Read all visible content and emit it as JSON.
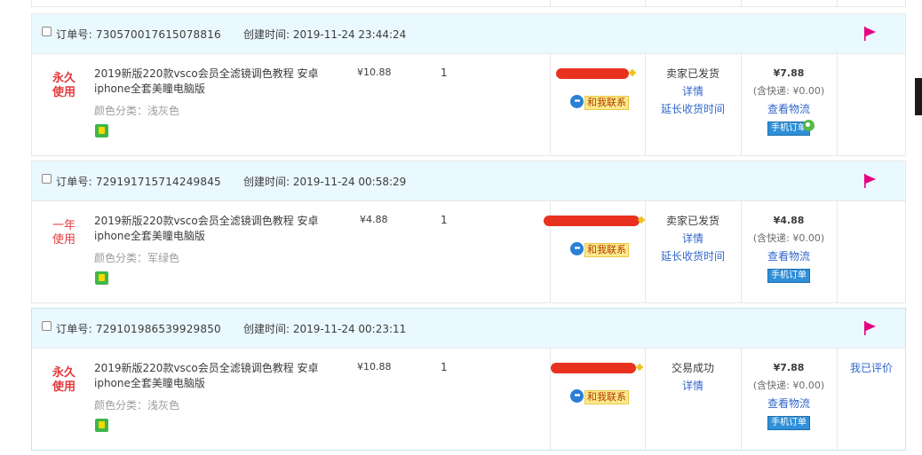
{
  "orders": [
    {
      "order_no": "订单号: 730570017615078816",
      "created": "创建时间: 2019-11-24 23:44:24",
      "usage_line1": "永久",
      "usage_line2": "使用",
      "title": "2019新版220款vsco会员全滤镜调色教程 安卓iphone全套美瞳电脑版",
      "sku": "颜色分类：浅灰色",
      "unit_price": "¥10.88",
      "qty": "1",
      "contact_label": "和我联系",
      "status": "卖家已发货",
      "detail": "详情",
      "extend": "延长收货时间",
      "total": "¥7.88",
      "shipping": "(含快递: ¥0.00)",
      "logistics": "查看物流",
      "mobile": "手机订单",
      "op": ""
    },
    {
      "order_no": "订单号: 729191715714249845",
      "created": "创建时间: 2019-11-24 00:58:29",
      "usage_line1": "一年",
      "usage_line2": "使用",
      "title": "2019新版220款vsco会员全滤镜调色教程 安卓iphone全套美瞳电脑版",
      "sku": "颜色分类：军绿色",
      "unit_price": "¥4.88",
      "qty": "1",
      "contact_label": "和我联系",
      "status": "卖家已发货",
      "detail": "详情",
      "extend": "延长收货时间",
      "total": "¥4.88",
      "shipping": "(含快递: ¥0.00)",
      "logistics": "查看物流",
      "mobile": "手机订单",
      "op": ""
    },
    {
      "order_no": "订单号: 729101986539929850",
      "created": "创建时间: 2019-11-24 00:23:11",
      "usage_line1": "永久",
      "usage_line2": "使用",
      "title": "2019新版220款vsco会员全滤镜调色教程 安卓iphone全套美瞳电脑版",
      "sku": "颜色分类：浅灰色",
      "unit_price": "¥10.88",
      "qty": "1",
      "contact_label": "和我联系",
      "status": "交易成功",
      "detail": "详情",
      "extend": "",
      "total": "¥7.88",
      "shipping": "(含快递: ¥0.00)",
      "logistics": "查看物流",
      "mobile": "手机订单",
      "op": "我已评价"
    }
  ],
  "colors": {
    "header_bg": "#eaf8ff",
    "accent_red": "#e4393c",
    "link_blue": "#3266cc",
    "flag_red": "#e4007f"
  },
  "icons": [
    "checkbox-icon",
    "flag-icon",
    "android-sku-icon",
    "wangwang-icon",
    "mobile-order-badge"
  ]
}
